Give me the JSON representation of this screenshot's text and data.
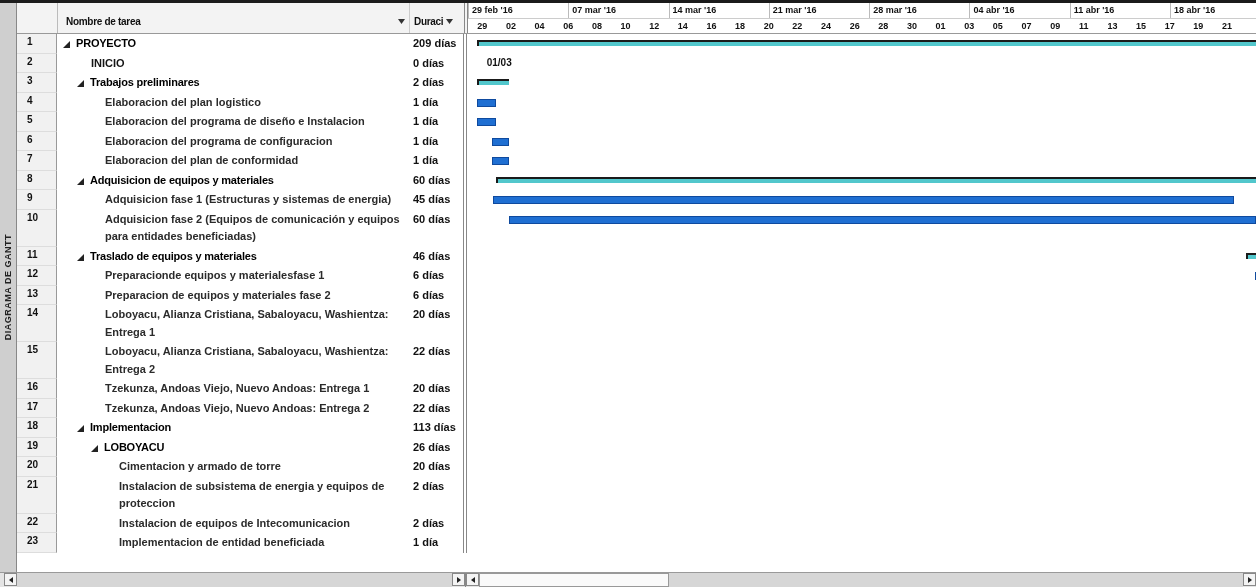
{
  "view_bar": {
    "label": "DIAGRAMA DE GANTT"
  },
  "columns": {
    "name": "Nombre de tarea",
    "duration": "Duraci"
  },
  "timescale": {
    "weeks": [
      "29 feb '16",
      "07 mar '16",
      "14 mar '16",
      "21 mar '16",
      "28 mar '16",
      "04 abr '16",
      "11 abr '16",
      "18 abr '16"
    ],
    "days": [
      "29",
      "02",
      "04",
      "06",
      "08",
      "10",
      "12",
      "14",
      "16",
      "18",
      "20",
      "22",
      "24",
      "26",
      "28",
      "30",
      "01",
      "03",
      "05",
      "07",
      "09",
      "11",
      "13",
      "15",
      "17",
      "19",
      "21"
    ]
  },
  "tasks": [
    {
      "row": "1",
      "name": "PROYECTO",
      "duration": "209 días",
      "kind": "summary",
      "expanded": true,
      "children": [
        {
          "row": "2",
          "name": "INICIO",
          "duration": "0 días",
          "kind": "milestone",
          "chart_label": "01/03"
        },
        {
          "row": "3",
          "name": "Trabajos preliminares",
          "duration": "2 días",
          "kind": "summary",
          "expanded": true,
          "children": [
            {
              "row": "4",
              "name": "Elaboracion del plan logistico",
              "duration": "1 día",
              "kind": "task"
            },
            {
              "row": "5",
              "name": "Elaboracion del programa de diseño e Instalacion",
              "duration": "1 día",
              "kind": "task"
            },
            {
              "row": "6",
              "name": "Elaboracion del programa de configuracion",
              "duration": "1 día",
              "kind": "task"
            },
            {
              "row": "7",
              "name": "Elaboracion del plan de conformidad",
              "duration": "1 día",
              "kind": "task"
            }
          ]
        },
        {
          "row": "8",
          "name": "Adquisicion de equipos y materiales",
          "duration": "60 días",
          "kind": "summary",
          "expanded": true,
          "children": [
            {
              "row": "9",
              "name": "Adquisicion fase 1 (Estructuras y sistemas de energia)",
              "duration": "45 días",
              "kind": "task"
            },
            {
              "row": "10",
              "name": "Adquisicion fase 2 (Equipos de comunicación y equipos para entidades beneficiadas)",
              "duration": "60 días",
              "kind": "task"
            }
          ]
        },
        {
          "row": "11",
          "name": "Traslado de equipos y materiales",
          "duration": "46 días",
          "kind": "summary",
          "expanded": true,
          "children": [
            {
              "row": "12",
              "name": "Preparacionde equipos y materialesfase 1",
              "duration": "6 días",
              "kind": "task"
            },
            {
              "row": "13",
              "name": "Preparacion de equipos y materiales fase 2",
              "duration": "6 días",
              "kind": "task"
            },
            {
              "row": "14",
              "name": "Loboyacu, Alianza Cristiana, Sabaloyacu, Washientza: Entrega 1",
              "duration": "20 días",
              "kind": "task"
            },
            {
              "row": "15",
              "name": "Loboyacu, Alianza Cristiana, Sabaloyacu, Washientza: Entrega 2",
              "duration": "22 días",
              "kind": "task"
            },
            {
              "row": "16",
              "name": "Tzekunza, Andoas Viejo, Nuevo Andoas: Entrega 1",
              "duration": "20 días",
              "kind": "task"
            },
            {
              "row": "17",
              "name": "Tzekunza, Andoas Viejo, Nuevo Andoas: Entrega 2",
              "duration": "22 días",
              "kind": "task"
            }
          ]
        },
        {
          "row": "18",
          "name": "Implementacion",
          "duration": "113 días",
          "kind": "summary",
          "expanded": true,
          "children": [
            {
              "row": "19",
              "name": "LOBOYACU",
              "duration": "26 días",
              "kind": "summary",
              "expanded": true,
              "children": [
                {
                  "row": "20",
                  "name": "Cimentacion y armado de torre",
                  "duration": "20 días",
                  "kind": "task"
                },
                {
                  "row": "21",
                  "name": "Instalacion de subsistema de energia y equipos de proteccion",
                  "duration": "2 días",
                  "kind": "task"
                },
                {
                  "row": "22",
                  "name": "Instalacion de equipos de Intecomunicacion",
                  "duration": "2 días",
                  "kind": "task"
                },
                {
                  "row": "23",
                  "name": "Implementacion de entidad beneficiada",
                  "duration": "1 día",
                  "kind": "task"
                }
              ]
            }
          ]
        }
      ]
    }
  ]
}
